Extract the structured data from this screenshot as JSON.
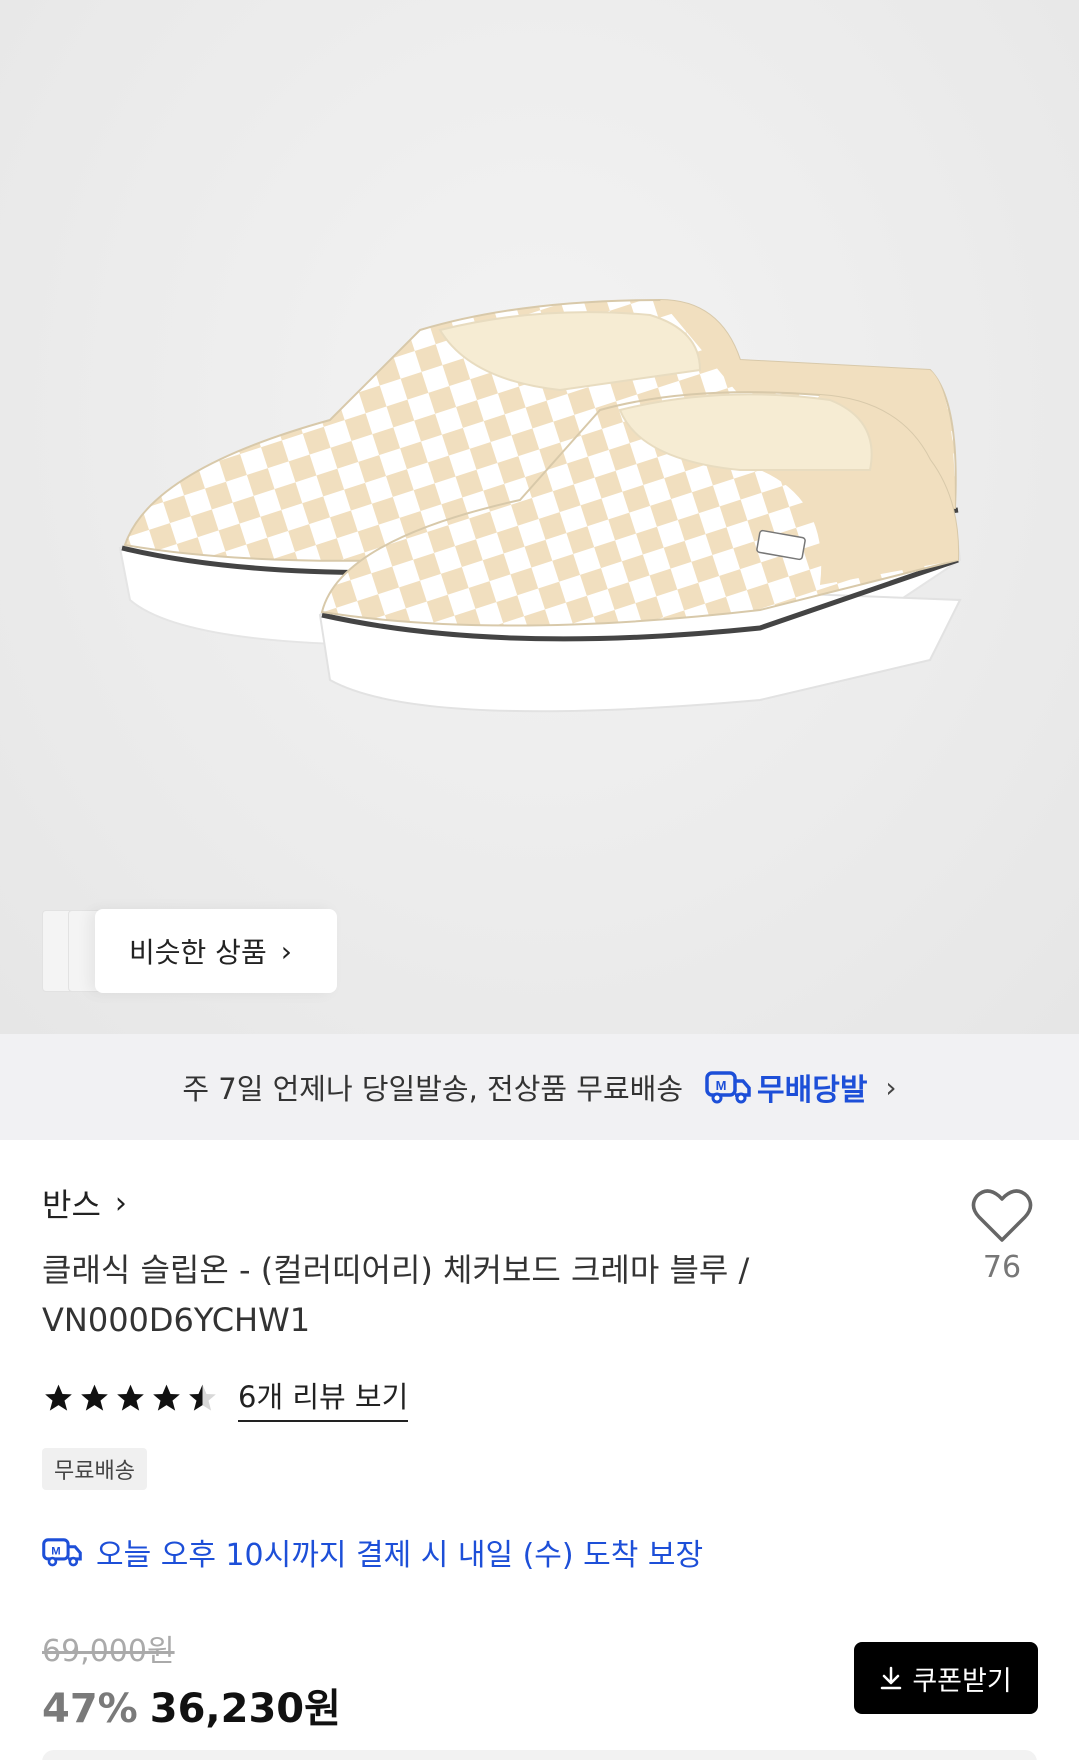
{
  "hero": {
    "image_alt": "checkerboard slip-on shoes",
    "similar_products_label": "비슷한 상품"
  },
  "shipping_banner": {
    "text": "주 7일 언제나 당일발송, 전상품 무료배송",
    "brand": "무배당발"
  },
  "product": {
    "brand": "반스",
    "title": "클래식 슬립온 - (컬러띠어리) 체커보드 크레마 블루 / VN000D6YCHW1",
    "like_count": "76",
    "rating": 4.5,
    "review_link": "6개 리뷰 보기",
    "badge": "무료배송",
    "delivery_notice": "오늘 오후 10시까지 결제 시 내일 (수) 도착 보장",
    "original_price": "69,000원",
    "discount_rate": "47%",
    "sale_price": "36,230원",
    "coupon_button": "쿠폰받기"
  },
  "colors": {
    "accent_blue": "#1d4fd8",
    "shoe_cream": "#f1dfbf"
  }
}
